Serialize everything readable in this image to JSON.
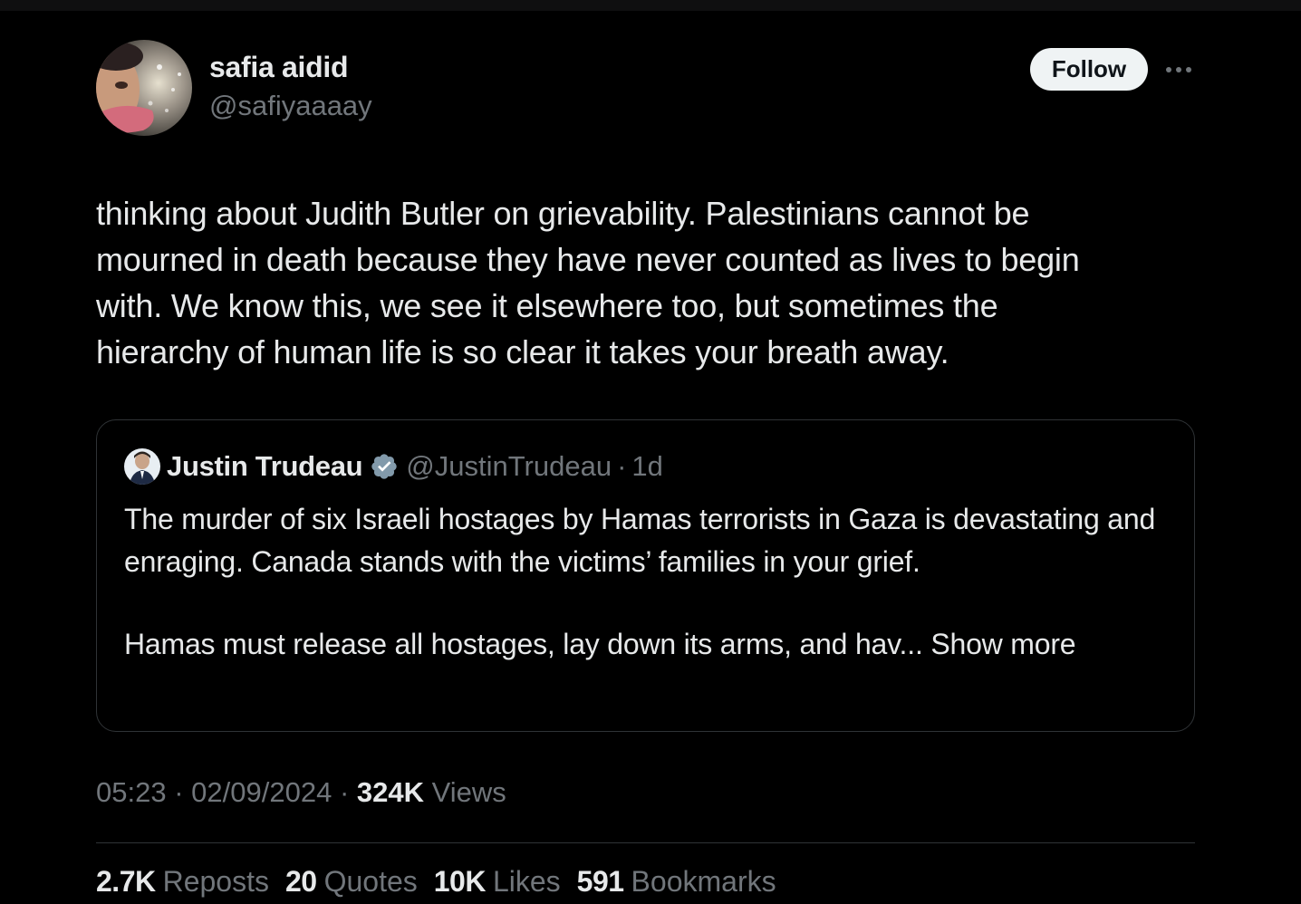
{
  "tweet": {
    "author": {
      "name": "safia aidid",
      "handle": "@safiyaaaay"
    },
    "follow_label": "Follow",
    "text": "thinking about Judith Butler on grievability. Palestinians cannot be\nmourned in death because they have never counted as lives to begin\nwith. We know this, we see it elsewhere too, but sometimes the\nhierarchy of human life is so clear it takes your breath away.",
    "quoted": {
      "author_name": "Justin Trudeau",
      "handle": "@JustinTrudeau",
      "separator": "·",
      "time": "1d",
      "paragraph_1": "The murder of six Israeli hostages by Hamas terrorists in Gaza is devastating and enraging. Canada stands with the victims’ families in your grief.",
      "paragraph_2": "Hamas must release all hostages, lay down its arms, and hav...",
      "show_more": "Show more"
    },
    "meta": {
      "time": "05:23",
      "separator": "·",
      "date": "02/09/2024",
      "views_count": "324K",
      "views_label": "Views"
    },
    "stats": [
      {
        "value": "2.7K",
        "label": "Reposts"
      },
      {
        "value": "20",
        "label": "Quotes"
      },
      {
        "value": "10K",
        "label": "Likes"
      },
      {
        "value": "591",
        "label": "Bookmarks"
      }
    ]
  },
  "icons": {
    "more": "more-horizontal-icon",
    "verified": "verified-badge-icon"
  },
  "colors": {
    "background": "#000000",
    "text_primary": "#e7e9ea",
    "text_secondary": "#71767b",
    "border": "#2f3336",
    "follow_button_bg": "#eff3f4",
    "verified_badge": "#829aab"
  }
}
